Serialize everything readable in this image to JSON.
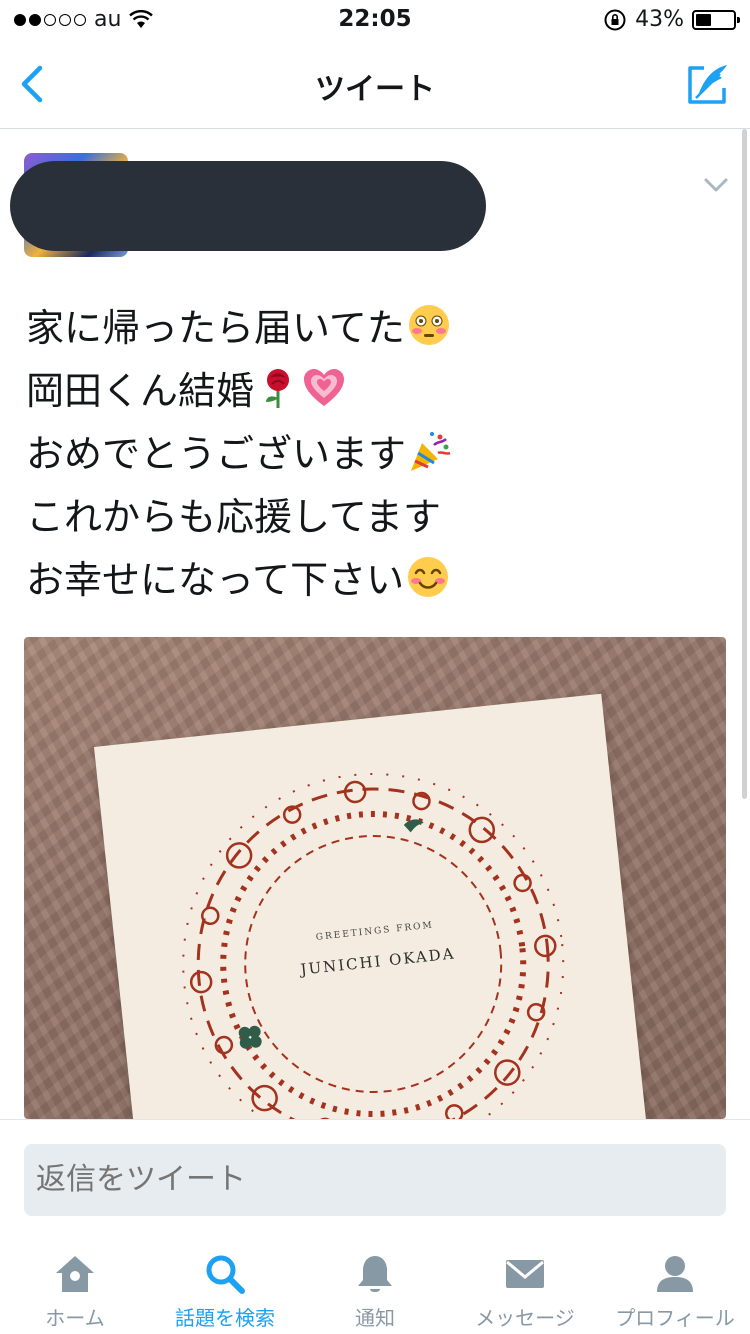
{
  "status": {
    "carrier": "au",
    "time": "22:05",
    "battery_percent": "43%",
    "battery_level": 0.43,
    "signal_bars": 2
  },
  "nav": {
    "title": "ツイート",
    "back_icon": "chevron-left-icon",
    "compose_icon": "compose-tweet-icon",
    "accent": "#1da1f2"
  },
  "tweet": {
    "lines": [
      {
        "text": "家に帰ったら届いてた",
        "emoji": [
          "flushed-face"
        ]
      },
      {
        "text": "岡田くん結婚",
        "emoji": [
          "rose",
          "growing-heart"
        ]
      },
      {
        "text": "おめでとうございます",
        "emoji": [
          "party-popper"
        ]
      },
      {
        "text": "これからも応援してます",
        "emoji": []
      },
      {
        "text": "お幸せになって下さい",
        "emoji": [
          "smiling-face"
        ]
      }
    ],
    "photo": {
      "card_small_text": "Greetings From",
      "card_big_text": "Junichi Okada"
    }
  },
  "reply": {
    "placeholder": "返信をツイート"
  },
  "tabs": [
    {
      "label": "ホーム",
      "icon": "home-icon",
      "active": false
    },
    {
      "label": "話題を検索",
      "icon": "search-icon",
      "active": true
    },
    {
      "label": "通知",
      "icon": "bell-icon",
      "active": false
    },
    {
      "label": "メッセージ",
      "icon": "envelope-icon",
      "active": false
    },
    {
      "label": "プロフィール",
      "icon": "person-icon",
      "active": false
    }
  ]
}
